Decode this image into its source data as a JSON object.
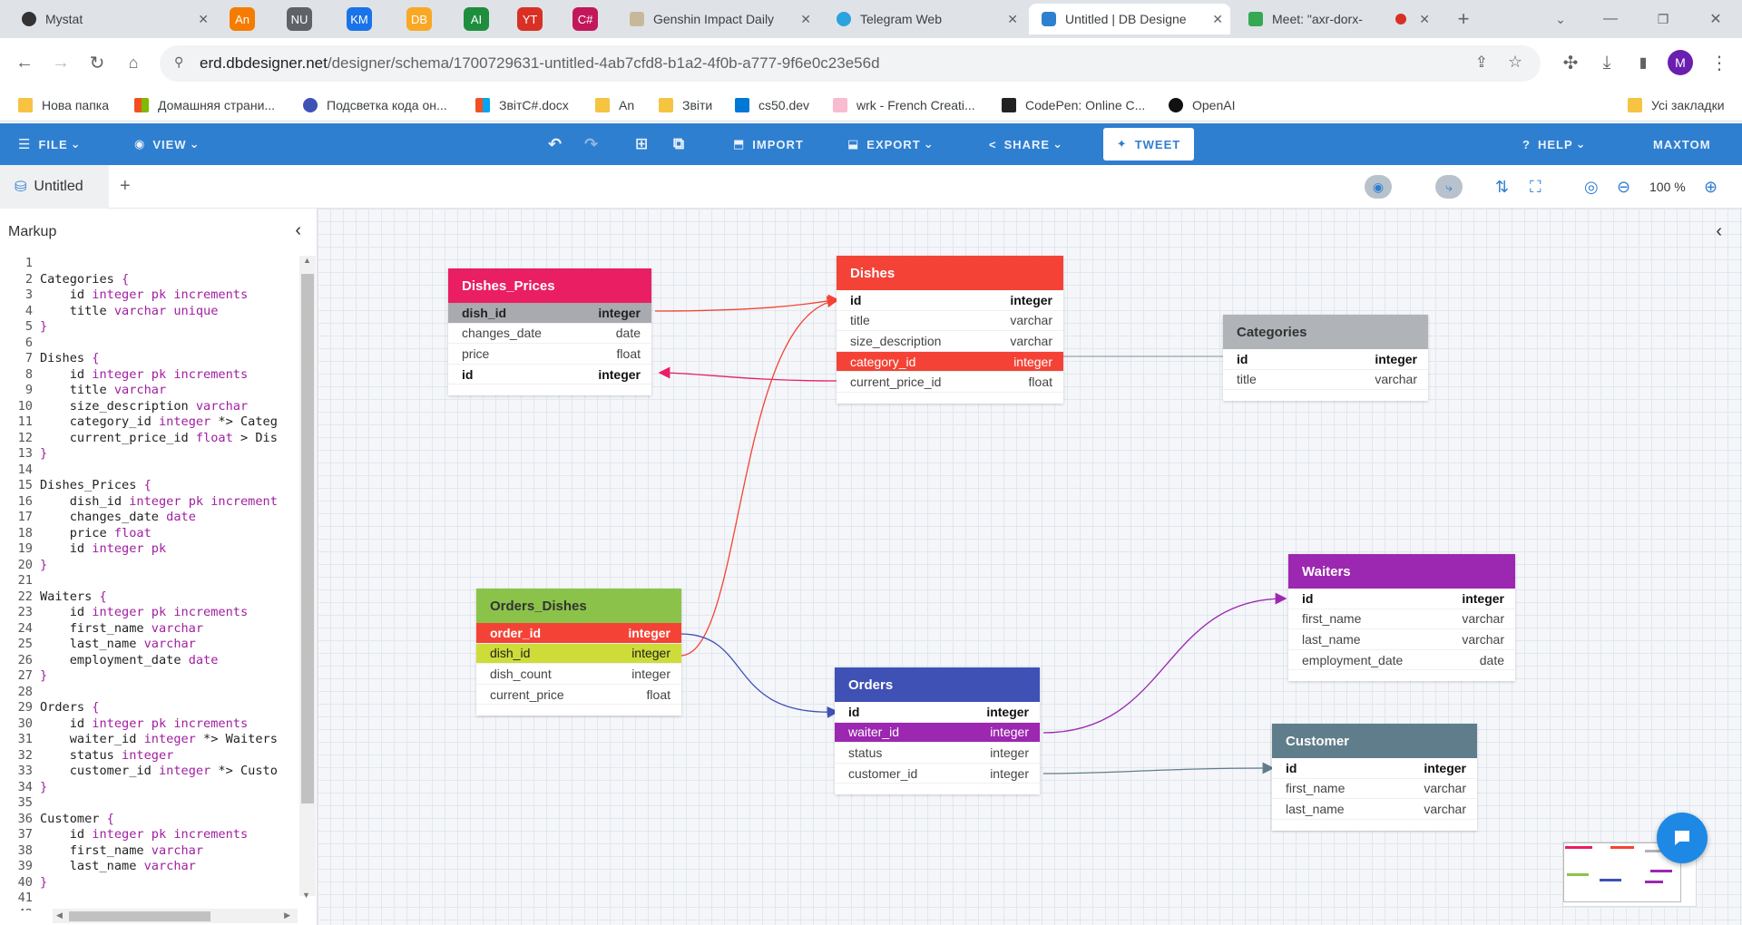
{
  "browser": {
    "pinned_tabs": [
      {
        "label": "An",
        "color": "#f57c00"
      },
      {
        "label": "NU",
        "color": "#5f6368"
      },
      {
        "label": "KM",
        "color": "#1a73e8"
      },
      {
        "label": "DB",
        "color": "#f9a825"
      },
      {
        "label": "AI",
        "color": "#1e8e3e"
      },
      {
        "label": "YT",
        "color": "#d93025"
      },
      {
        "label": "C#",
        "color": "#c2185b"
      }
    ],
    "tabs": [
      {
        "title": "Mystat"
      },
      {
        "title": "Genshin Impact Daily"
      },
      {
        "title": "Telegram Web"
      },
      {
        "title": "Untitled | DB Designe"
      },
      {
        "title": "Meet: \"axr-dorx-"
      }
    ],
    "url_host": "erd.dbdesigner.net",
    "url_path": "/designer/schema/1700729631-untitled-4ab7cfd8-b1a2-4f0b-a777-9f6e0c23e56d",
    "profile_initial": "M",
    "bookmarks": [
      "Нова папка",
      "Домашняя страни...",
      "Подсветка кода он...",
      "ЗвітC#.docx",
      "An",
      "Звіти",
      "cs50.dev",
      "wrk - French Creati...",
      "CodePen: Online C...",
      "OpenAI"
    ],
    "all_bookmarks": "Усі закладки"
  },
  "toolbar": {
    "file": "FILE",
    "view": "VIEW",
    "import": "IMPORT",
    "export": "EXPORT",
    "share": "SHARE",
    "tweet": "TWEET",
    "help": "HELP",
    "user": "MAXTOM"
  },
  "doc": {
    "tab": "Untitled",
    "add": "+",
    "zoom": "100 %"
  },
  "markup": {
    "title": "Markup",
    "lines": [
      [
        {
          "t": ""
        }
      ],
      [
        {
          "t": "Categories "
        },
        {
          "t": "{",
          "c": "br"
        }
      ],
      [
        {
          "t": "    id "
        },
        {
          "t": "integer pk increments",
          "c": "kw"
        }
      ],
      [
        {
          "t": "    title "
        },
        {
          "t": "varchar unique",
          "c": "kw"
        }
      ],
      [
        {
          "t": "}",
          "c": "br"
        }
      ],
      [
        {
          "t": ""
        }
      ],
      [
        {
          "t": "Dishes "
        },
        {
          "t": "{",
          "c": "br"
        }
      ],
      [
        {
          "t": "    id "
        },
        {
          "t": "integer pk increments",
          "c": "kw"
        }
      ],
      [
        {
          "t": "    title "
        },
        {
          "t": "varchar",
          "c": "kw"
        }
      ],
      [
        {
          "t": "    size_description "
        },
        {
          "t": "varchar",
          "c": "kw"
        }
      ],
      [
        {
          "t": "    category_id "
        },
        {
          "t": "integer",
          "c": "kw"
        },
        {
          "t": " *> Categ"
        }
      ],
      [
        {
          "t": "    current_price_id "
        },
        {
          "t": "float",
          "c": "kw"
        },
        {
          "t": " > Dis"
        }
      ],
      [
        {
          "t": "}",
          "c": "br"
        }
      ],
      [
        {
          "t": ""
        }
      ],
      [
        {
          "t": "Dishes_Prices "
        },
        {
          "t": "{",
          "c": "br"
        }
      ],
      [
        {
          "t": "    dish_id "
        },
        {
          "t": "integer pk increment",
          "c": "kw"
        }
      ],
      [
        {
          "t": "    changes_date "
        },
        {
          "t": "date",
          "c": "kw"
        }
      ],
      [
        {
          "t": "    price "
        },
        {
          "t": "float",
          "c": "kw"
        }
      ],
      [
        {
          "t": "    id "
        },
        {
          "t": "integer pk",
          "c": "kw"
        }
      ],
      [
        {
          "t": "}",
          "c": "br"
        }
      ],
      [
        {
          "t": ""
        }
      ],
      [
        {
          "t": "Waiters "
        },
        {
          "t": "{",
          "c": "br"
        }
      ],
      [
        {
          "t": "    id "
        },
        {
          "t": "integer pk increments",
          "c": "kw"
        }
      ],
      [
        {
          "t": "    first_name "
        },
        {
          "t": "varchar",
          "c": "kw"
        }
      ],
      [
        {
          "t": "    last_name "
        },
        {
          "t": "varchar",
          "c": "kw"
        }
      ],
      [
        {
          "t": "    employment_date "
        },
        {
          "t": "date",
          "c": "kw"
        }
      ],
      [
        {
          "t": "}",
          "c": "br"
        }
      ],
      [
        {
          "t": ""
        }
      ],
      [
        {
          "t": "Orders "
        },
        {
          "t": "{",
          "c": "br"
        }
      ],
      [
        {
          "t": "    id "
        },
        {
          "t": "integer pk increments",
          "c": "kw"
        }
      ],
      [
        {
          "t": "    waiter_id "
        },
        {
          "t": "integer",
          "c": "kw"
        },
        {
          "t": " *> Waiters"
        }
      ],
      [
        {
          "t": "    status "
        },
        {
          "t": "integer",
          "c": "kw"
        }
      ],
      [
        {
          "t": "    customer_id "
        },
        {
          "t": "integer",
          "c": "kw"
        },
        {
          "t": " *> Custo"
        }
      ],
      [
        {
          "t": "}",
          "c": "br"
        }
      ],
      [
        {
          "t": ""
        }
      ],
      [
        {
          "t": "Customer "
        },
        {
          "t": "{",
          "c": "br"
        }
      ],
      [
        {
          "t": "    id "
        },
        {
          "t": "integer pk increments",
          "c": "kw"
        }
      ],
      [
        {
          "t": "    first_name "
        },
        {
          "t": "varchar",
          "c": "kw"
        }
      ],
      [
        {
          "t": "    last_name "
        },
        {
          "t": "varchar",
          "c": "kw"
        }
      ],
      [
        {
          "t": "}",
          "c": "br"
        }
      ],
      [
        {
          "t": ""
        }
      ],
      [
        {
          "t": ""
        }
      ]
    ]
  },
  "tables": {
    "dishes_prices": {
      "name": "Dishes_Prices",
      "color": "#e91e63",
      "rows": [
        {
          "f": "dish_id",
          "t": "integer",
          "pk": true,
          "hl": "#a9a9b0"
        },
        {
          "f": "changes_date",
          "t": "date"
        },
        {
          "f": "price",
          "t": "float"
        },
        {
          "f": "id",
          "t": "integer",
          "pk": true
        }
      ]
    },
    "dishes": {
      "name": "Dishes",
      "color": "#f44336",
      "rows": [
        {
          "f": "id",
          "t": "integer",
          "pk": true
        },
        {
          "f": "title",
          "t": "varchar"
        },
        {
          "f": "size_description",
          "t": "varchar"
        },
        {
          "f": "category_id",
          "t": "integer",
          "hl": "#f44336"
        },
        {
          "f": "current_price_id",
          "t": "float"
        }
      ]
    },
    "categories": {
      "name": "Categories",
      "color": "#b0b4b8",
      "dark": true,
      "rows": [
        {
          "f": "id",
          "t": "integer",
          "pk": true
        },
        {
          "f": "title",
          "t": "varchar"
        }
      ]
    },
    "waiters": {
      "name": "Waiters",
      "color": "#9c27b0",
      "rows": [
        {
          "f": "id",
          "t": "integer",
          "pk": true
        },
        {
          "f": "first_name",
          "t": "varchar"
        },
        {
          "f": "last_name",
          "t": "varchar"
        },
        {
          "f": "employment_date",
          "t": "date"
        }
      ]
    },
    "orders_dishes": {
      "name": "Orders_Dishes",
      "color": "#8bc34a",
      "dark": true,
      "rows": [
        {
          "f": "order_id",
          "t": "integer",
          "pk": true,
          "hl": "#f44336"
        },
        {
          "f": "dish_id",
          "t": "integer",
          "hl": "#cddc39"
        },
        {
          "f": "dish_count",
          "t": "integer"
        },
        {
          "f": "current_price",
          "t": "float"
        }
      ]
    },
    "orders": {
      "name": "Orders",
      "color": "#3f51b5",
      "rows": [
        {
          "f": "id",
          "t": "integer",
          "pk": true
        },
        {
          "f": "waiter_id",
          "t": "integer",
          "hl": "#9c27b0"
        },
        {
          "f": "status",
          "t": "integer"
        },
        {
          "f": "customer_id",
          "t": "integer"
        }
      ]
    },
    "customer": {
      "name": "Customer",
      "color": "#607d8b",
      "rows": [
        {
          "f": "id",
          "t": "integer",
          "pk": true
        },
        {
          "f": "first_name",
          "t": "varchar"
        },
        {
          "f": "last_name",
          "t": "varchar"
        }
      ]
    }
  }
}
